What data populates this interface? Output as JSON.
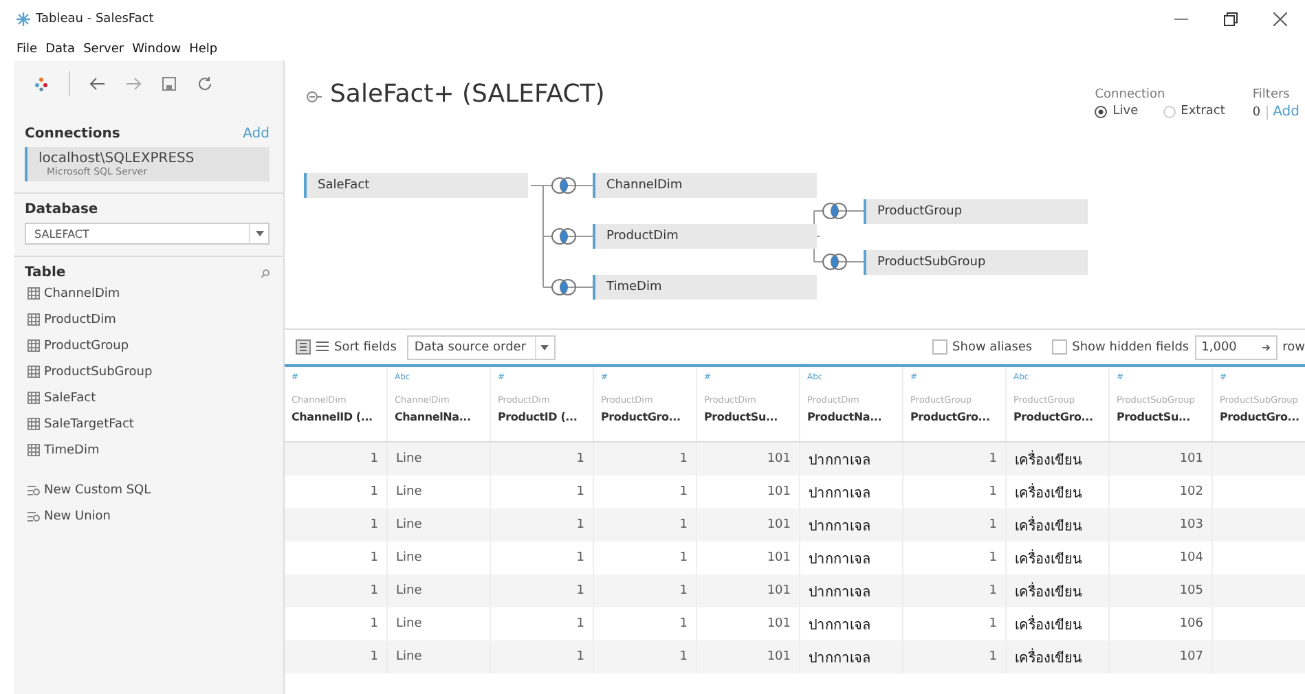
{
  "window": {
    "title": "Tableau - SalesFact"
  },
  "menu": [
    "File",
    "Data",
    "Server",
    "Window",
    "Help"
  ],
  "sidebar": {
    "connections_label": "Connections",
    "add_link": "Add",
    "connection": {
      "name": "localhost\\SQLEXPRESS",
      "type": "Microsoft SQL Server"
    },
    "database_label": "Database",
    "database": "SALEFACT",
    "table_label": "Table",
    "tables": [
      {
        "label": "ChannelDim",
        "kind": "table"
      },
      {
        "label": "ProductDim",
        "kind": "table"
      },
      {
        "label": "ProductGroup",
        "kind": "table"
      },
      {
        "label": "ProductSubGroup",
        "kind": "table"
      },
      {
        "label": "SaleFact",
        "kind": "table"
      },
      {
        "label": "SaleTargetFact",
        "kind": "table"
      },
      {
        "label": "TimeDim",
        "kind": "table"
      },
      {
        "label": "New Custom SQL",
        "kind": "sql"
      },
      {
        "label": "New Union",
        "kind": "sql"
      }
    ]
  },
  "datasource": {
    "title": "SaleFact+ (SALEFACT)",
    "connection_label": "Connection",
    "connection_options": [
      {
        "label": "Live",
        "selected": true
      },
      {
        "label": "Extract",
        "selected": false
      }
    ],
    "filters_label": "Filters",
    "filters_count": "0",
    "filters_add": "Add"
  },
  "diagram": {
    "root": {
      "label": "SaleFact",
      "children": [
        {
          "label": "ChannelDim"
        },
        {
          "label": "ProductDim",
          "children": [
            {
              "label": "ProductGroup"
            },
            {
              "label": "ProductSubGroup"
            }
          ]
        },
        {
          "label": "TimeDim"
        }
      ]
    }
  },
  "toolbar": {
    "sort_label": "Sort fields",
    "sort_value": "Data source order",
    "show_aliases": {
      "label": "Show aliases",
      "checked": false
    },
    "show_hidden": {
      "label": "Show hidden fields",
      "checked": false
    },
    "rows_value": "1,000",
    "rows_label": "row"
  },
  "table": {
    "columns": [
      {
        "type": "#",
        "source": "ChannelDim",
        "name": "ChannelID (..."
      },
      {
        "type": "Abc",
        "source": "ChannelDim",
        "name": "ChannelNa..."
      },
      {
        "type": "#",
        "source": "ProductDim",
        "name": "ProductID (..."
      },
      {
        "type": "#",
        "source": "ProductDim",
        "name": "ProductGro..."
      },
      {
        "type": "#",
        "source": "ProductDim",
        "name": "ProductSu..."
      },
      {
        "type": "Abc",
        "source": "ProductDim",
        "name": "ProductNa..."
      },
      {
        "type": "#",
        "source": "ProductGroup",
        "name": "ProductGro..."
      },
      {
        "type": "Abc",
        "source": "ProductGroup",
        "name": "ProductGro..."
      },
      {
        "type": "#",
        "source": "ProductSubGroup",
        "name": "ProductSu..."
      },
      {
        "type": "#",
        "source": "ProductSubGroup",
        "name": "ProductGro..."
      }
    ],
    "rows": [
      [
        "1",
        "Line",
        "1",
        "1",
        "101",
        "ปากกาเจล",
        "1",
        "เครื่องเขียน",
        "101"
      ],
      [
        "1",
        "Line",
        "1",
        "1",
        "101",
        "ปากกาเจล",
        "1",
        "เครื่องเขียน",
        "102"
      ],
      [
        "1",
        "Line",
        "1",
        "1",
        "101",
        "ปากกาเจล",
        "1",
        "เครื่องเขียน",
        "103"
      ],
      [
        "1",
        "Line",
        "1",
        "1",
        "101",
        "ปากกาเจล",
        "1",
        "เครื่องเขียน",
        "104"
      ],
      [
        "1",
        "Line",
        "1",
        "1",
        "101",
        "ปากกาเจล",
        "1",
        "เครื่องเขียน",
        "105"
      ],
      [
        "1",
        "Line",
        "1",
        "1",
        "101",
        "ปากกาเจล",
        "1",
        "เครื่องเขียน",
        "106"
      ],
      [
        "1",
        "Line",
        "1",
        "1",
        "101",
        "ปากกาเจล",
        "1",
        "เครื่องเขียน",
        "107"
      ]
    ]
  }
}
